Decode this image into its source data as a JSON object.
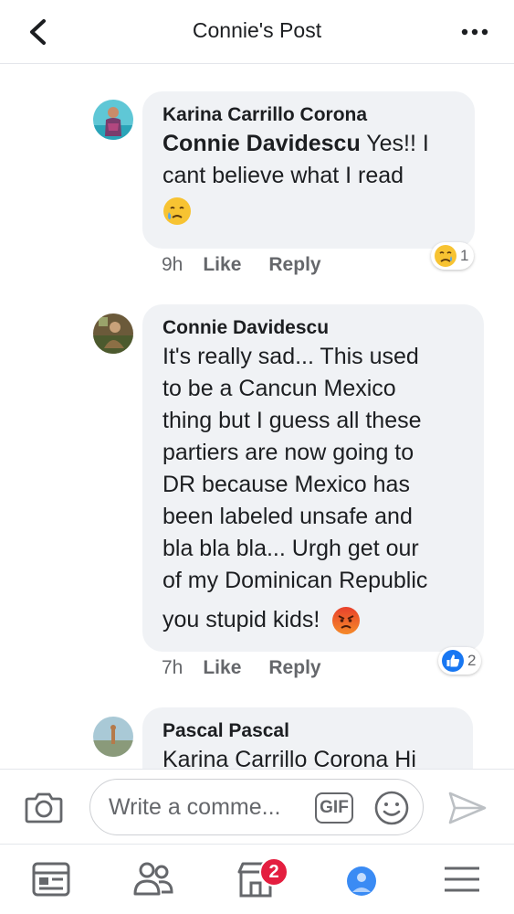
{
  "header": {
    "title": "Connie's Post"
  },
  "comments": [
    {
      "author": "Karina Carrillo Corona",
      "mention": "Connie Davidescu",
      "text_line1": " Yes!! I",
      "text_line2": "cant believe what I read",
      "emoji": "sad-tear-emoji",
      "time": "9h",
      "like_label": "Like",
      "reply_label": "Reply",
      "reaction": {
        "icon": "sad-face-emoji",
        "count": "1"
      }
    },
    {
      "author": "Connie Davidescu",
      "lines": [
        "It's really sad... This used",
        "to be a Cancun Mexico",
        "thing but I guess all these",
        "partiers are now going to",
        "DR because Mexico has",
        "been labeled unsafe and",
        "bla bla bla... Urgh get our",
        "of my Dominican Republic",
        "you stupid kids!"
      ],
      "emoji": "angry-face-emoji",
      "time": "7h",
      "like_label": "Like",
      "reply_label": "Reply",
      "reaction": {
        "icon": "thumbs-up-icon",
        "count": "2"
      }
    },
    {
      "author": "Pascal Pascal",
      "text_line1": "Karina Carrillo Corona  Hi"
    }
  ],
  "composer": {
    "placeholder": "Write a comme...",
    "gif_label": "GIF"
  },
  "tabbar": {
    "marketplace_badge": "2"
  },
  "colors": {
    "brand_blue": "#1877f2",
    "badge_red": "#e41e3f",
    "bubble_grey": "#f0f2f5",
    "icon_grey": "#65676b"
  }
}
